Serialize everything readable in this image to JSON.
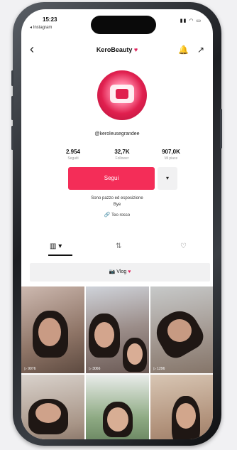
{
  "status_bar": {
    "time": "15:23",
    "back_app": "◂ Instagram",
    "icons": "▮▮ ◠ ▭"
  },
  "nav": {
    "back": "‹",
    "username": "KeroBeauty",
    "heart": "♥",
    "bell": "🔔",
    "share": "↗"
  },
  "profile": {
    "handle": "@keroleusegrandee"
  },
  "stats": [
    {
      "value": "2.954",
      "label": "Seguiti"
    },
    {
      "value": "32,7K",
      "label": "Follower"
    },
    {
      "value": "907,0K",
      "label": "Mi piace"
    }
  ],
  "actions": {
    "follow": "Segui",
    "more": "▾"
  },
  "bio": {
    "line1": "Sono pazzo ed esposizione",
    "line2": "Bye"
  },
  "link": {
    "icon": "🔗",
    "text": "Teo rosso"
  },
  "tabs": {
    "grid": "▥ ▾",
    "repost": "⇅",
    "liked": "♡"
  },
  "playlist": {
    "label": "Vlog",
    "icon": "📷",
    "heart": "♥"
  },
  "videos": [
    {
      "views": "▷ 9076"
    },
    {
      "views": "▷ 3066"
    },
    {
      "views": "▷ 1296"
    },
    {
      "views": ""
    },
    {
      "views": ""
    },
    {
      "views": ""
    }
  ],
  "colors": {
    "accent": "#f42d58",
    "heart": "#e0245e"
  }
}
